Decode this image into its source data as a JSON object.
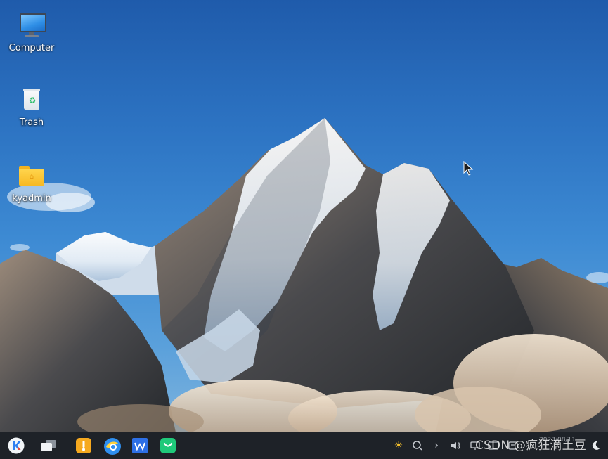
{
  "desktop": {
    "icons": [
      {
        "label": "Computer",
        "icon": "computer-icon"
      },
      {
        "label": "Trash",
        "icon": "trash-icon"
      },
      {
        "label": "kyadmin",
        "icon": "home-folder-icon"
      }
    ]
  },
  "taskbar": {
    "apps": [
      {
        "name": "start-menu",
        "icon": "kylin-start-icon"
      },
      {
        "name": "multitask-view",
        "icon": "multitask-icon"
      },
      {
        "name": "toolbox",
        "icon": "toolbox-icon",
        "color": "#f5a623"
      },
      {
        "name": "browser",
        "icon": "browser-icon",
        "color": "#2f8ff0"
      },
      {
        "name": "wps",
        "icon": "wps-icon",
        "color": "#2d6fe6"
      },
      {
        "name": "software-store",
        "icon": "store-icon",
        "color": "#1fc97a"
      }
    ],
    "tray": [
      "brightness-icon",
      "search-icon",
      "chevron-right-icon",
      "volume-icon",
      "network-icon",
      "input-method-icon",
      "notification-icon",
      "night-mode-icon"
    ],
    "clock": {
      "time": "",
      "date": "2023/08/11"
    }
  },
  "watermark": "CSDN @疯狂滴土豆",
  "colors": {
    "taskbar": "#1e2228",
    "sky": "#2d74c3",
    "accent": "#2f8ff0"
  }
}
